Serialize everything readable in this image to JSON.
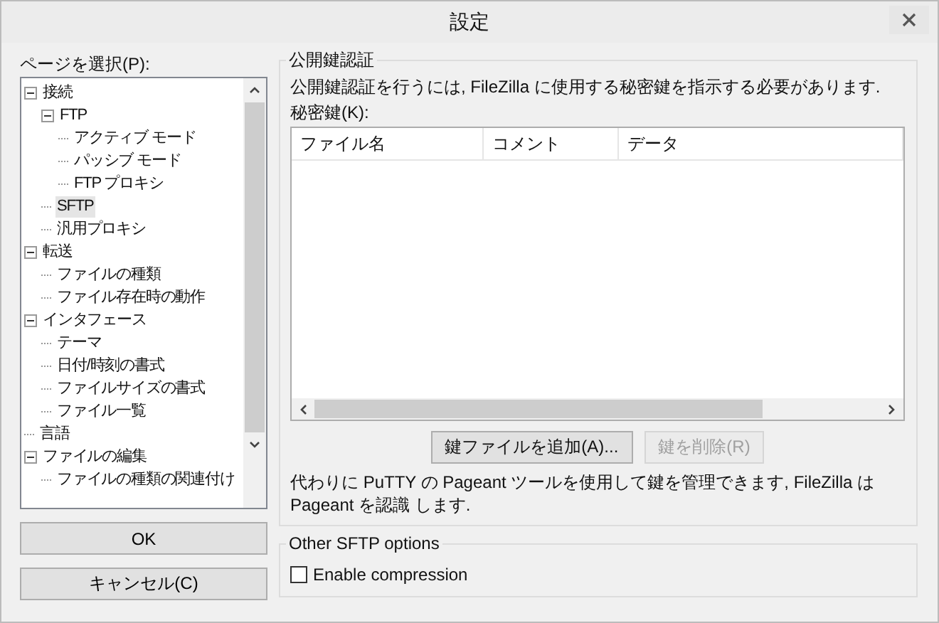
{
  "window": {
    "title": "設定"
  },
  "sidebar": {
    "label": "ページを選択(P):",
    "tree": [
      {
        "label": "接続",
        "expanded": true,
        "selected": false,
        "children": [
          {
            "label": "FTP",
            "expanded": true,
            "selected": false,
            "children": [
              {
                "label": "アクティブ モード",
                "selected": false
              },
              {
                "label": "パッシブ モード",
                "selected": false
              },
              {
                "label": "FTP プロキシ",
                "selected": false
              }
            ]
          },
          {
            "label": "SFTP",
            "selected": true
          },
          {
            "label": "汎用プロキシ",
            "selected": false
          }
        ]
      },
      {
        "label": "転送",
        "expanded": true,
        "selected": false,
        "children": [
          {
            "label": "ファイルの種類",
            "selected": false
          },
          {
            "label": "ファイル存在時の動作",
            "selected": false
          }
        ]
      },
      {
        "label": "インタフェース",
        "expanded": true,
        "selected": false,
        "children": [
          {
            "label": "テーマ",
            "selected": false
          },
          {
            "label": "日付/時刻の書式",
            "selected": false
          },
          {
            "label": "ファイルサイズの書式",
            "selected": false
          },
          {
            "label": "ファイル一覧",
            "selected": false
          }
        ]
      },
      {
        "label": "言語",
        "selected": false
      },
      {
        "label": "ファイルの編集",
        "expanded": true,
        "selected": false,
        "children": [
          {
            "label": "ファイルの種類の関連付け",
            "selected": false
          }
        ]
      }
    ]
  },
  "dialog_buttons": [
    {
      "label": "OK"
    },
    {
      "label": "キャンセル(C)"
    }
  ],
  "public_key_group": {
    "title": "公開鍵認証",
    "description": "公開鍵認証を行うには, FileZilla に使用する秘密鍵を指示する必要があります.",
    "key_label": "秘密鍵(K):",
    "columns": [
      "ファイル名",
      "コメント",
      "データ"
    ],
    "buttons": [
      {
        "label": "鍵ファイルを追加(A)...",
        "disabled": false
      },
      {
        "label": "鍵を削除(R)",
        "disabled": true
      }
    ],
    "note": "代わりに PuTTY の Pageant ツールを使用して鍵を管理できます, FileZilla は Pageant を認識 します."
  },
  "sftp_options_group": {
    "title": "Other SFTP options",
    "checkbox": {
      "label": "Enable compression",
      "checked": false
    }
  }
}
